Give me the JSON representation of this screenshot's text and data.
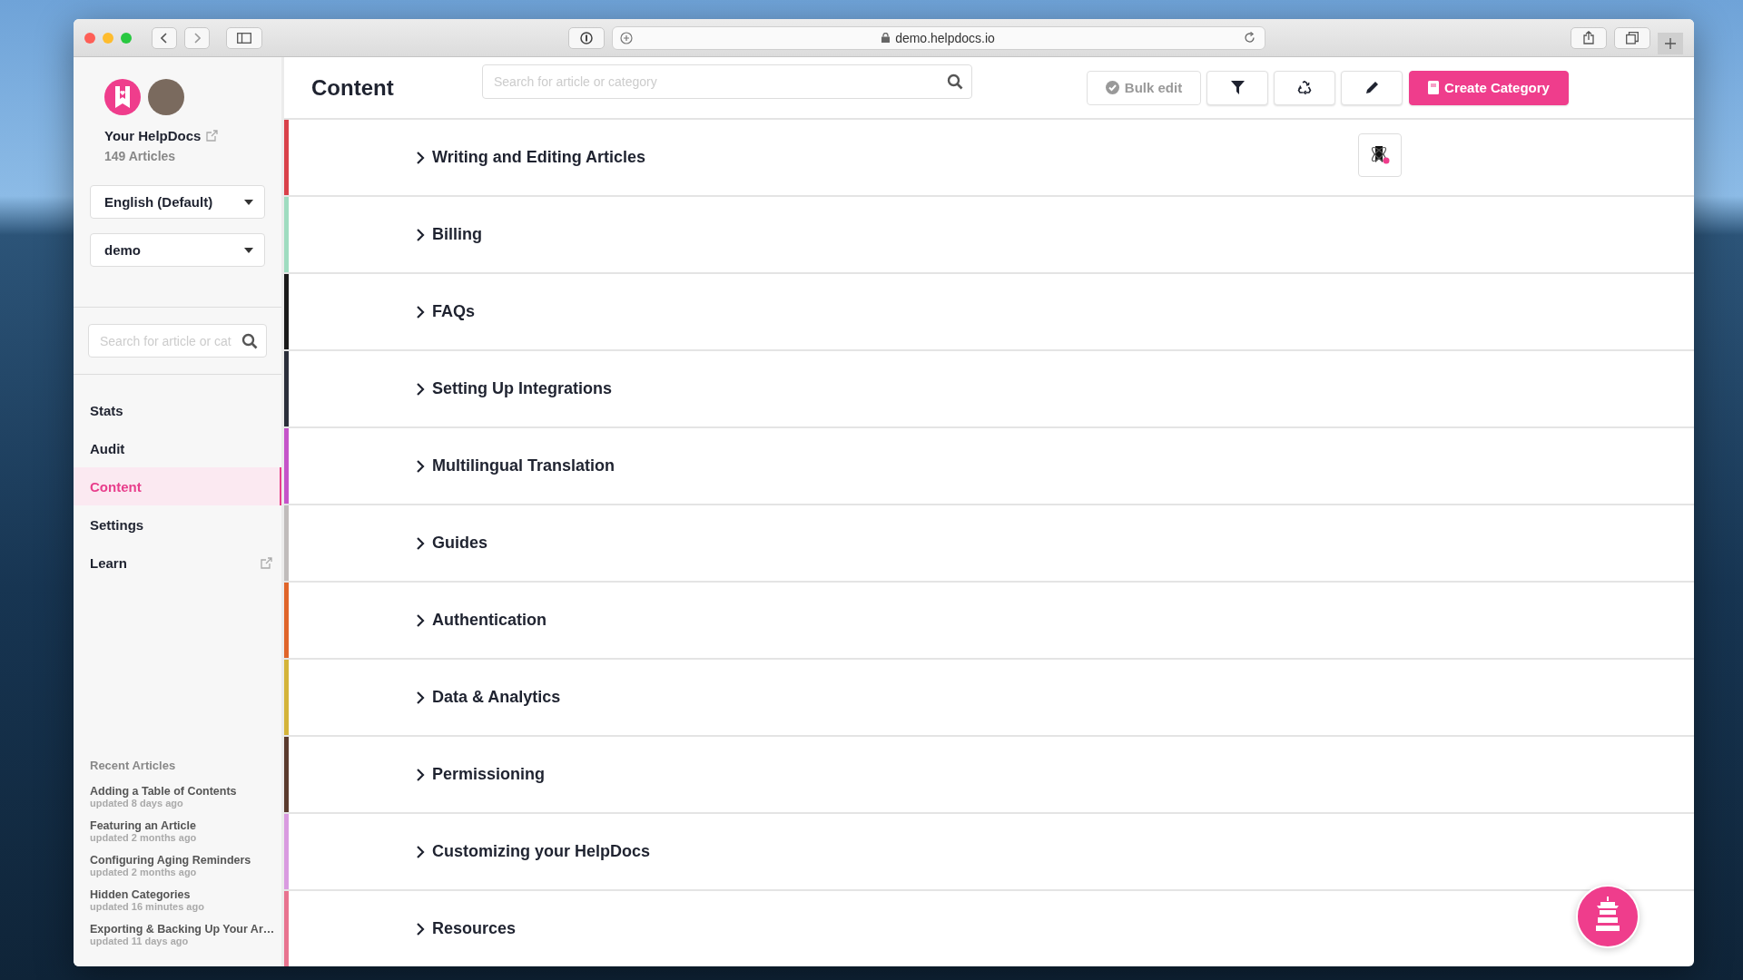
{
  "browser": {
    "url": "demo.helpdocs.io"
  },
  "sidebar": {
    "site_name": "Your HelpDocs",
    "article_count": "149 Articles",
    "language_select": "English (Default)",
    "project_select": "demo",
    "search": {
      "placeholder": "Search for article or cat"
    },
    "nav": [
      {
        "label": "Stats",
        "kind": "link",
        "selected": false
      },
      {
        "label": "Audit",
        "kind": "link",
        "selected": false
      },
      {
        "label": "Content",
        "kind": "link",
        "selected": true
      },
      {
        "label": "Settings",
        "kind": "link",
        "selected": false
      },
      {
        "label": "Learn",
        "kind": "external",
        "selected": false
      }
    ],
    "recent_title": "Recent Articles",
    "recent_articles": [
      {
        "title": "Adding a Table of Contents",
        "updated": "updated 8 days ago"
      },
      {
        "title": "Featuring an Article",
        "updated": "updated 2 months ago"
      },
      {
        "title": "Configuring Aging Reminders",
        "updated": "updated 2 months ago"
      },
      {
        "title": "Hidden Categories",
        "updated": "updated 16 minutes ago"
      },
      {
        "title": "Exporting & Backing Up Your Ar…",
        "updated": "updated 11 days ago"
      }
    ]
  },
  "header": {
    "title": "Content",
    "search": {
      "placeholder": "Search for article or category"
    },
    "bulk_edit": "Bulk edit",
    "create_category": "Create Category"
  },
  "categories": [
    {
      "name": "Writing and Editing Articles",
      "color": "#d9414a",
      "icon_button": true
    },
    {
      "name": "Billing",
      "color": "#9fdcc0",
      "icon_button": false
    },
    {
      "name": "FAQs",
      "color": "#1a1a1a",
      "icon_button": false
    },
    {
      "name": "Setting Up Integrations",
      "color": "#2b2f3a",
      "icon_button": false
    },
    {
      "name": "Multilingual Translation",
      "color": "#c554c9",
      "icon_button": false
    },
    {
      "name": "Guides",
      "color": "#c0bcbb",
      "icon_button": false
    },
    {
      "name": "Authentication",
      "color": "#e0652a",
      "icon_button": false
    },
    {
      "name": "Data & Analytics",
      "color": "#d4b43a",
      "icon_button": false
    },
    {
      "name": "Permissioning",
      "color": "#5a3a2e",
      "icon_button": false
    },
    {
      "name": "Customizing your HelpDocs",
      "color": "#d99be0",
      "icon_button": false
    },
    {
      "name": "Resources",
      "color": "#e8738f",
      "icon_button": false
    }
  ]
}
